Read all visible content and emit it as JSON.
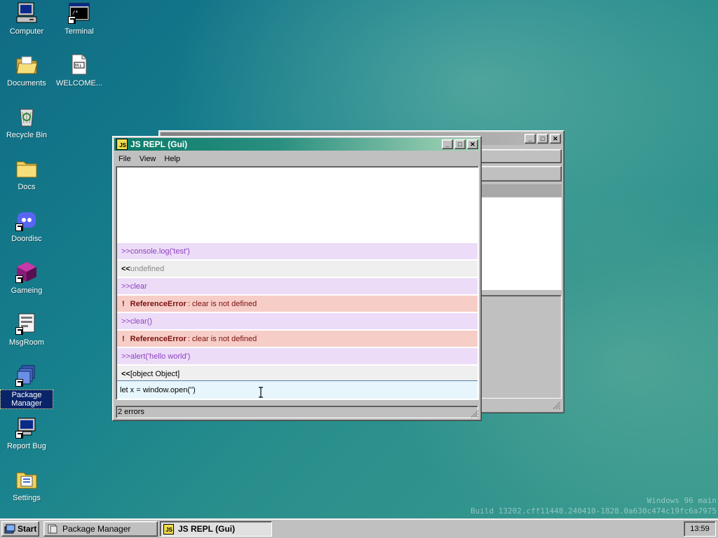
{
  "desktop": {
    "icons": [
      {
        "label": "Computer",
        "icon": "computer-icon"
      },
      {
        "label": "Terminal",
        "icon": "terminal-icon"
      },
      {
        "label": "Documents",
        "icon": "folder-open-icon"
      },
      {
        "label": "WELCOME...",
        "icon": "markdown-file-icon"
      },
      {
        "label": "Recycle Bin",
        "icon": "recycle-bin-icon"
      },
      {
        "label": "Docs",
        "icon": "folder-icon"
      },
      {
        "label": "Doordisc",
        "icon": "doordisc-icon"
      },
      {
        "label": "Gameing",
        "icon": "game-icon"
      },
      {
        "label": "MsgRoom",
        "icon": "msgroom-icon"
      },
      {
        "label": "Package Manager",
        "icon": "package-manager-icon"
      },
      {
        "label": "Report Bug",
        "icon": "report-bug-icon"
      },
      {
        "label": "Settings",
        "icon": "settings-icon"
      }
    ],
    "selected_icon": "Package Manager",
    "build_line_1": "Windows 96 main",
    "build_line_2": "Build 13202.cff11448.240410-1828.0a630c474c19fc6a7975"
  },
  "repl_window": {
    "title": "JS REPL (Gui)",
    "badge": "JS",
    "menu": [
      "File",
      "View",
      "Help"
    ],
    "log": [
      {
        "kind": "input",
        "prefix": ">>",
        "text": "console.log('test')"
      },
      {
        "kind": "output",
        "prefix": "<<",
        "text": "undefined"
      },
      {
        "kind": "input",
        "prefix": ">>",
        "text": "clear"
      },
      {
        "kind": "error",
        "prefix": "!",
        "name": "ReferenceError",
        "text": ": clear is not defined"
      },
      {
        "kind": "input",
        "prefix": ">>",
        "text": "clear()"
      },
      {
        "kind": "error",
        "prefix": "!",
        "name": "ReferenceError",
        "text": ": clear is not defined"
      },
      {
        "kind": "input",
        "prefix": ">>",
        "text": "alert('hello world')"
      },
      {
        "kind": "output",
        "prefix": "<<",
        "text": "[object Object]"
      }
    ],
    "input_value": "let x = window.open('')",
    "status": "2 errors"
  },
  "taskbar": {
    "start_label": "Start",
    "tasks": [
      {
        "label": "Package Manager",
        "active": false
      },
      {
        "label": "JS REPL (Gui)",
        "active": true
      }
    ],
    "clock": "13:59"
  }
}
